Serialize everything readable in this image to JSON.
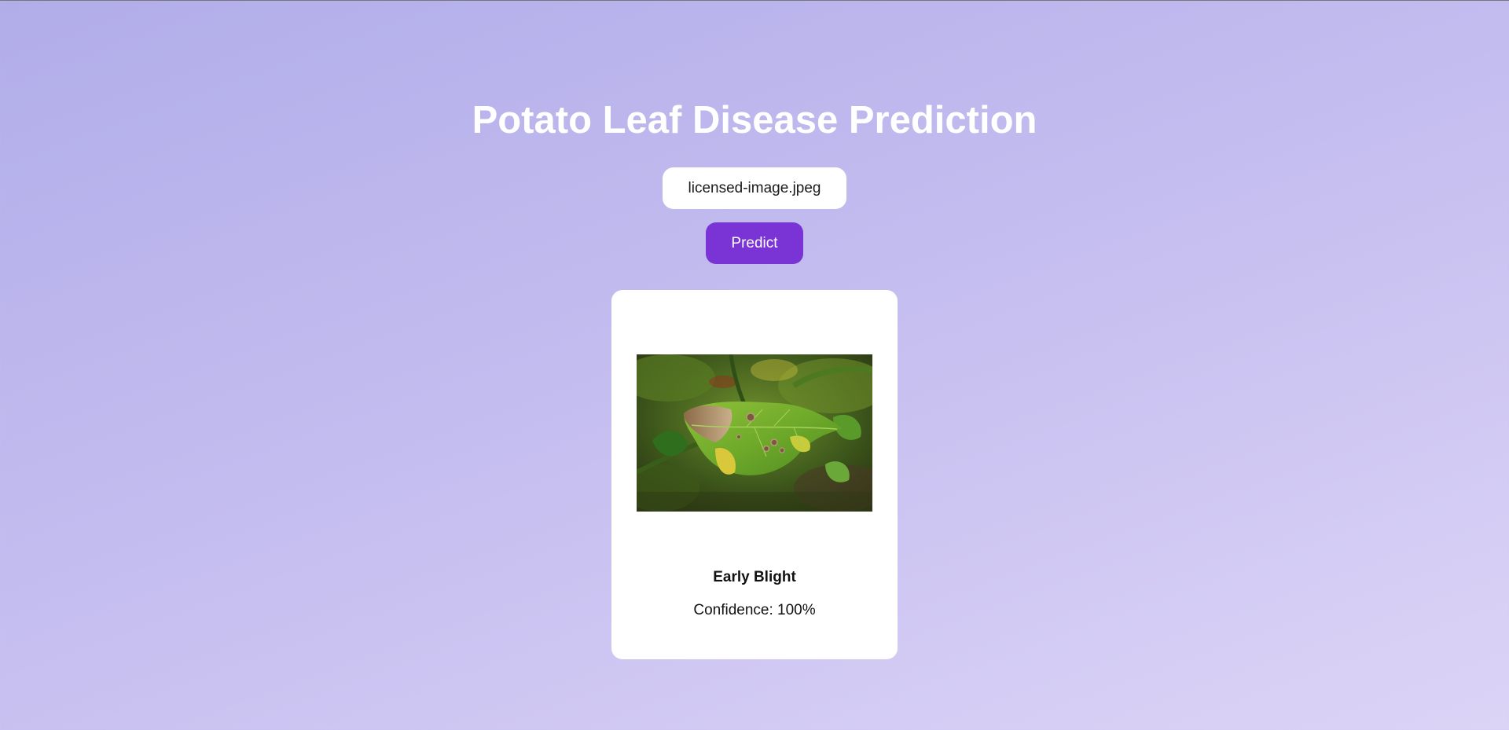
{
  "header": {
    "title": "Potato Leaf Disease Prediction"
  },
  "upload": {
    "file_name": "licensed-image.jpeg",
    "predict_label": "Predict"
  },
  "result": {
    "class_label": "Early Blight",
    "confidence_text": "Confidence: 100%",
    "confidence_value": 100
  },
  "colors": {
    "accent": "#7a34d6",
    "background_start": "#b1ade9",
    "background_end": "#dcd4f6",
    "card": "#ffffff"
  }
}
